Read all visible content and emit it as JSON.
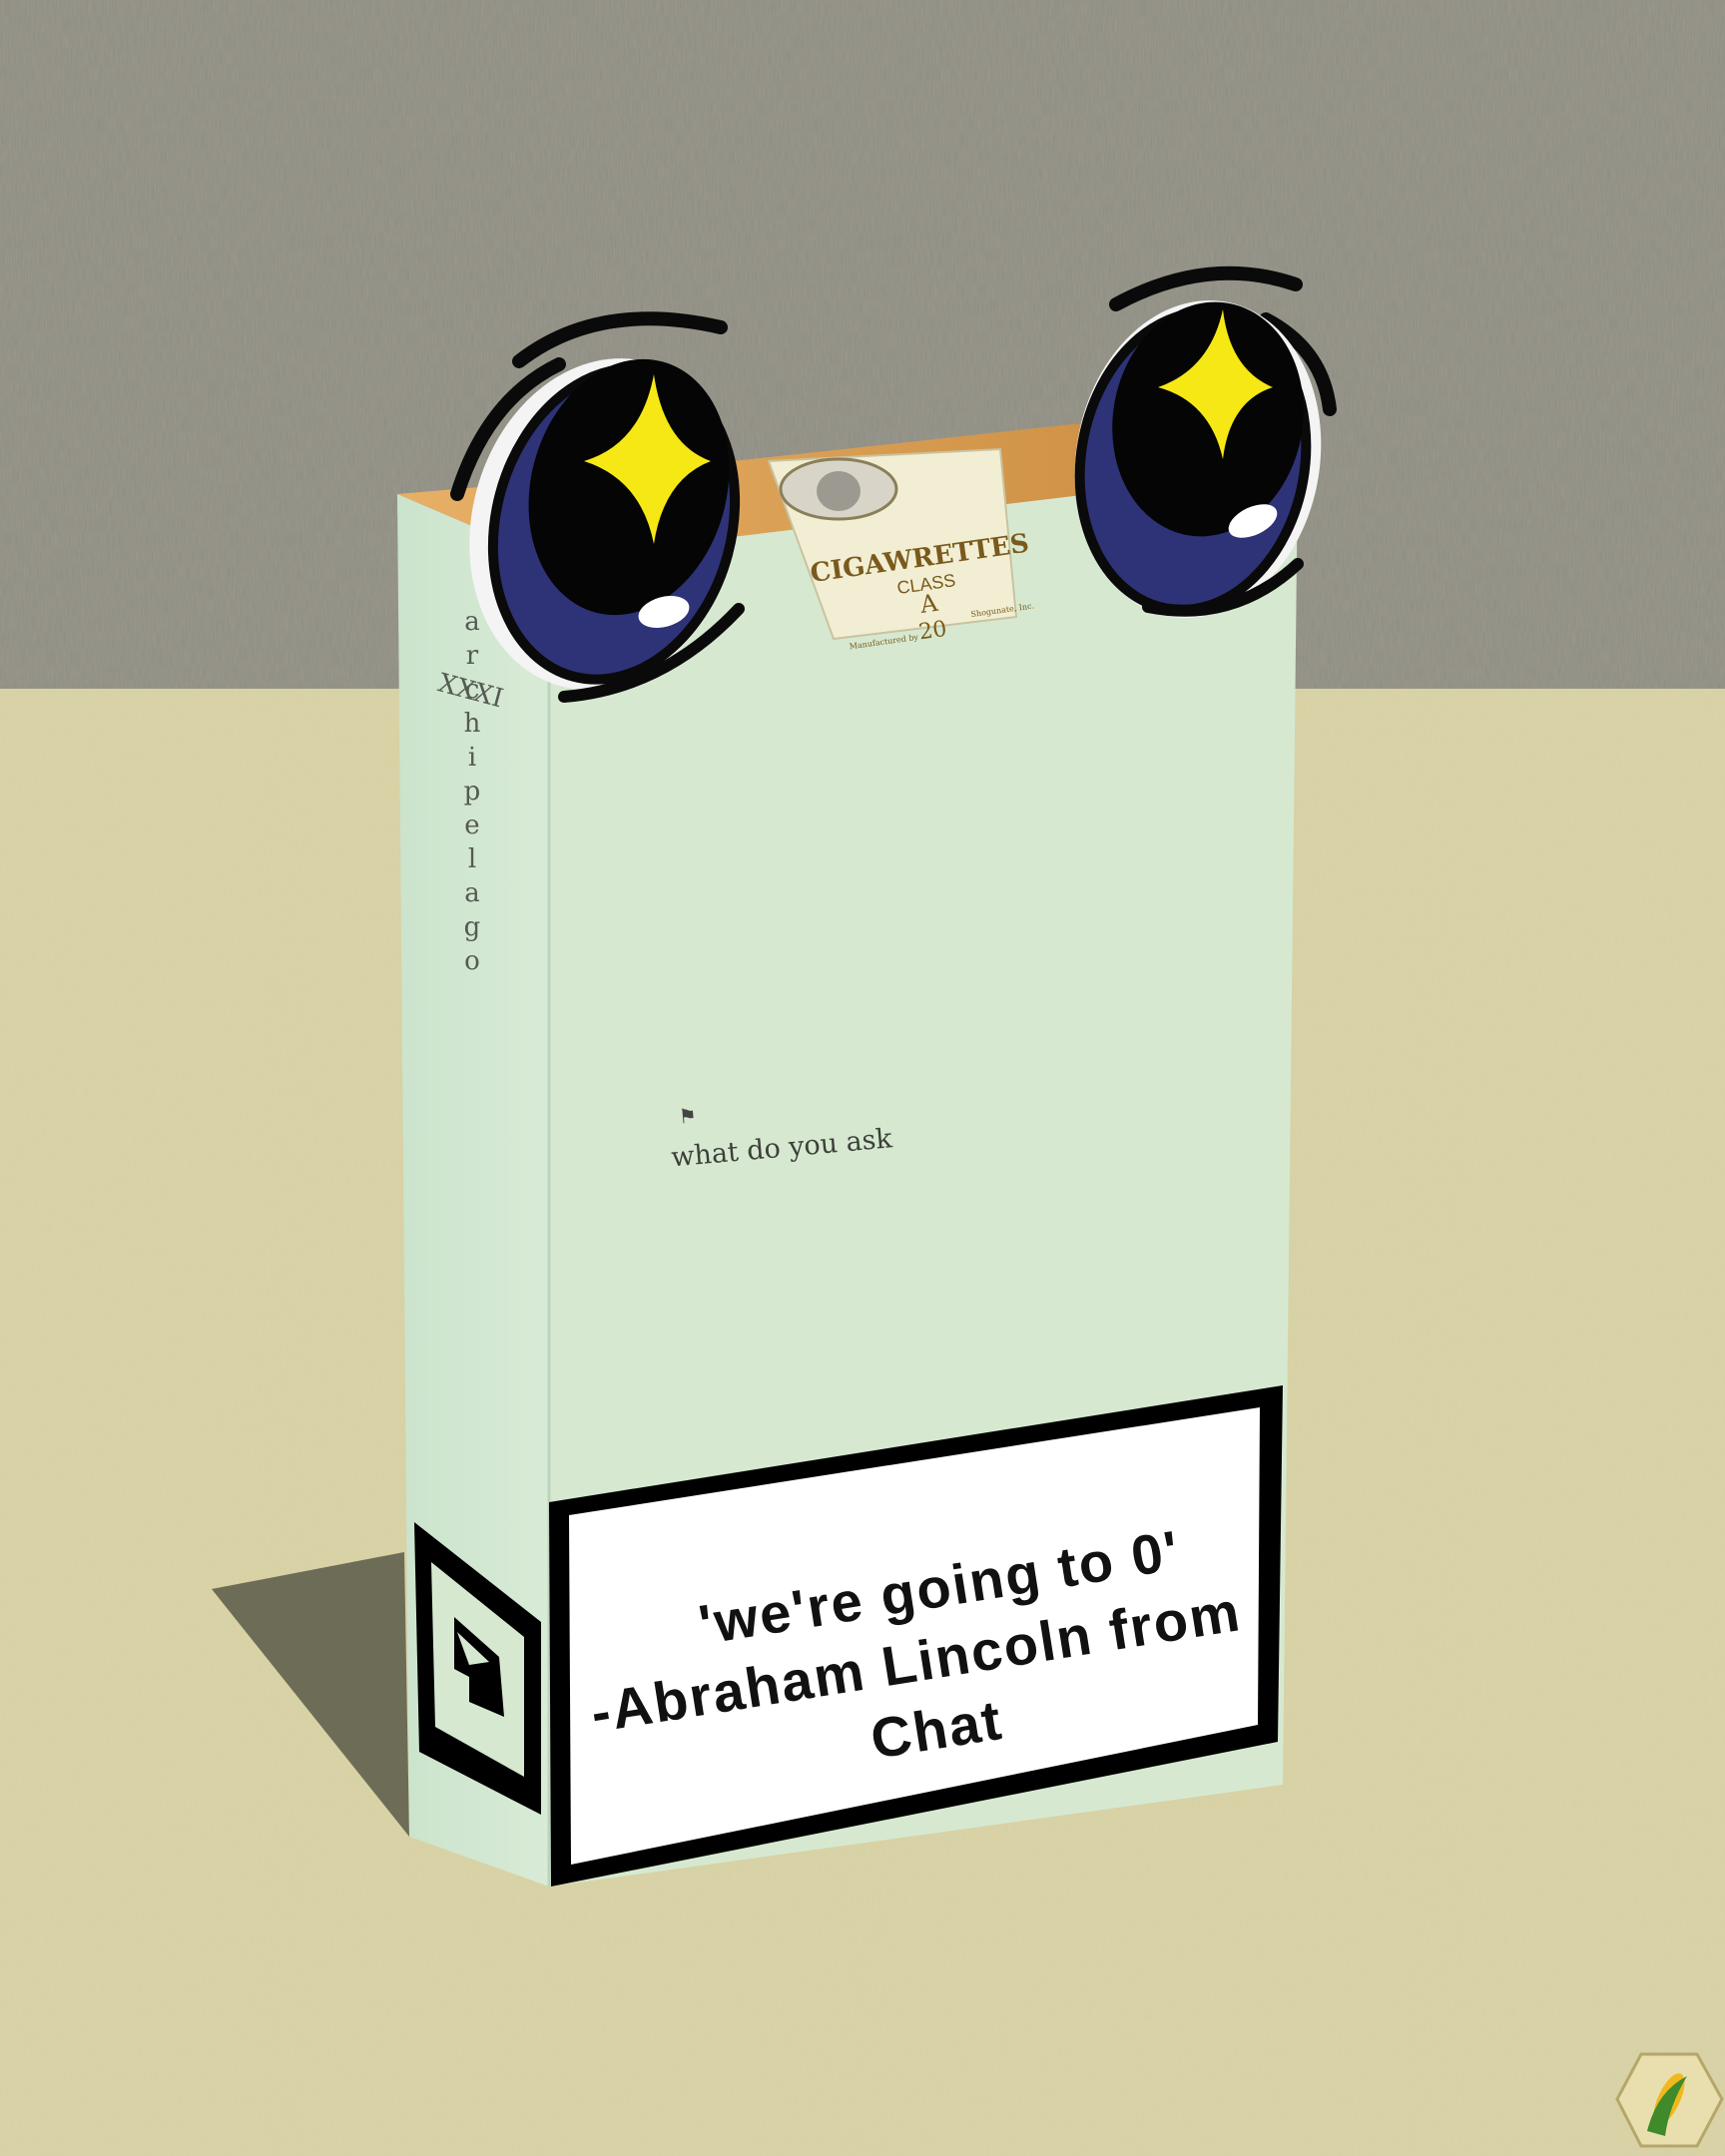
{
  "artwork": {
    "spine": {
      "numeral": "XXXI",
      "word": "archipelago"
    },
    "front": {
      "caption": "what do you ask"
    },
    "stamp": {
      "brand": "CIGAWRETTES",
      "class_label": "CLASS",
      "grade": "A",
      "count": "20",
      "left_small": "Manufactured by",
      "right_small": "Shogunate, Inc."
    },
    "warning": {
      "line1": "'we're going to 0'",
      "line2": "-Abraham Lincoln from",
      "line3": "Chat"
    },
    "icons": {
      "stamp_portrait": "portrait-icon",
      "side_logo": "abstract-logo-icon",
      "corner_badge": "corn-hexagon-badge-icon"
    },
    "colors": {
      "wall": "#8e8c80",
      "table": "#d9d3a6",
      "box_front": "#d5e8cf",
      "box_side": "#cfe5cf",
      "box_top": "#d79a4d",
      "stamp": "#f1eed3",
      "eye_iris": "#2e3377",
      "sparkle": "#f5e814",
      "warning_border": "#000000",
      "warning_fill": "#ffffff"
    }
  }
}
